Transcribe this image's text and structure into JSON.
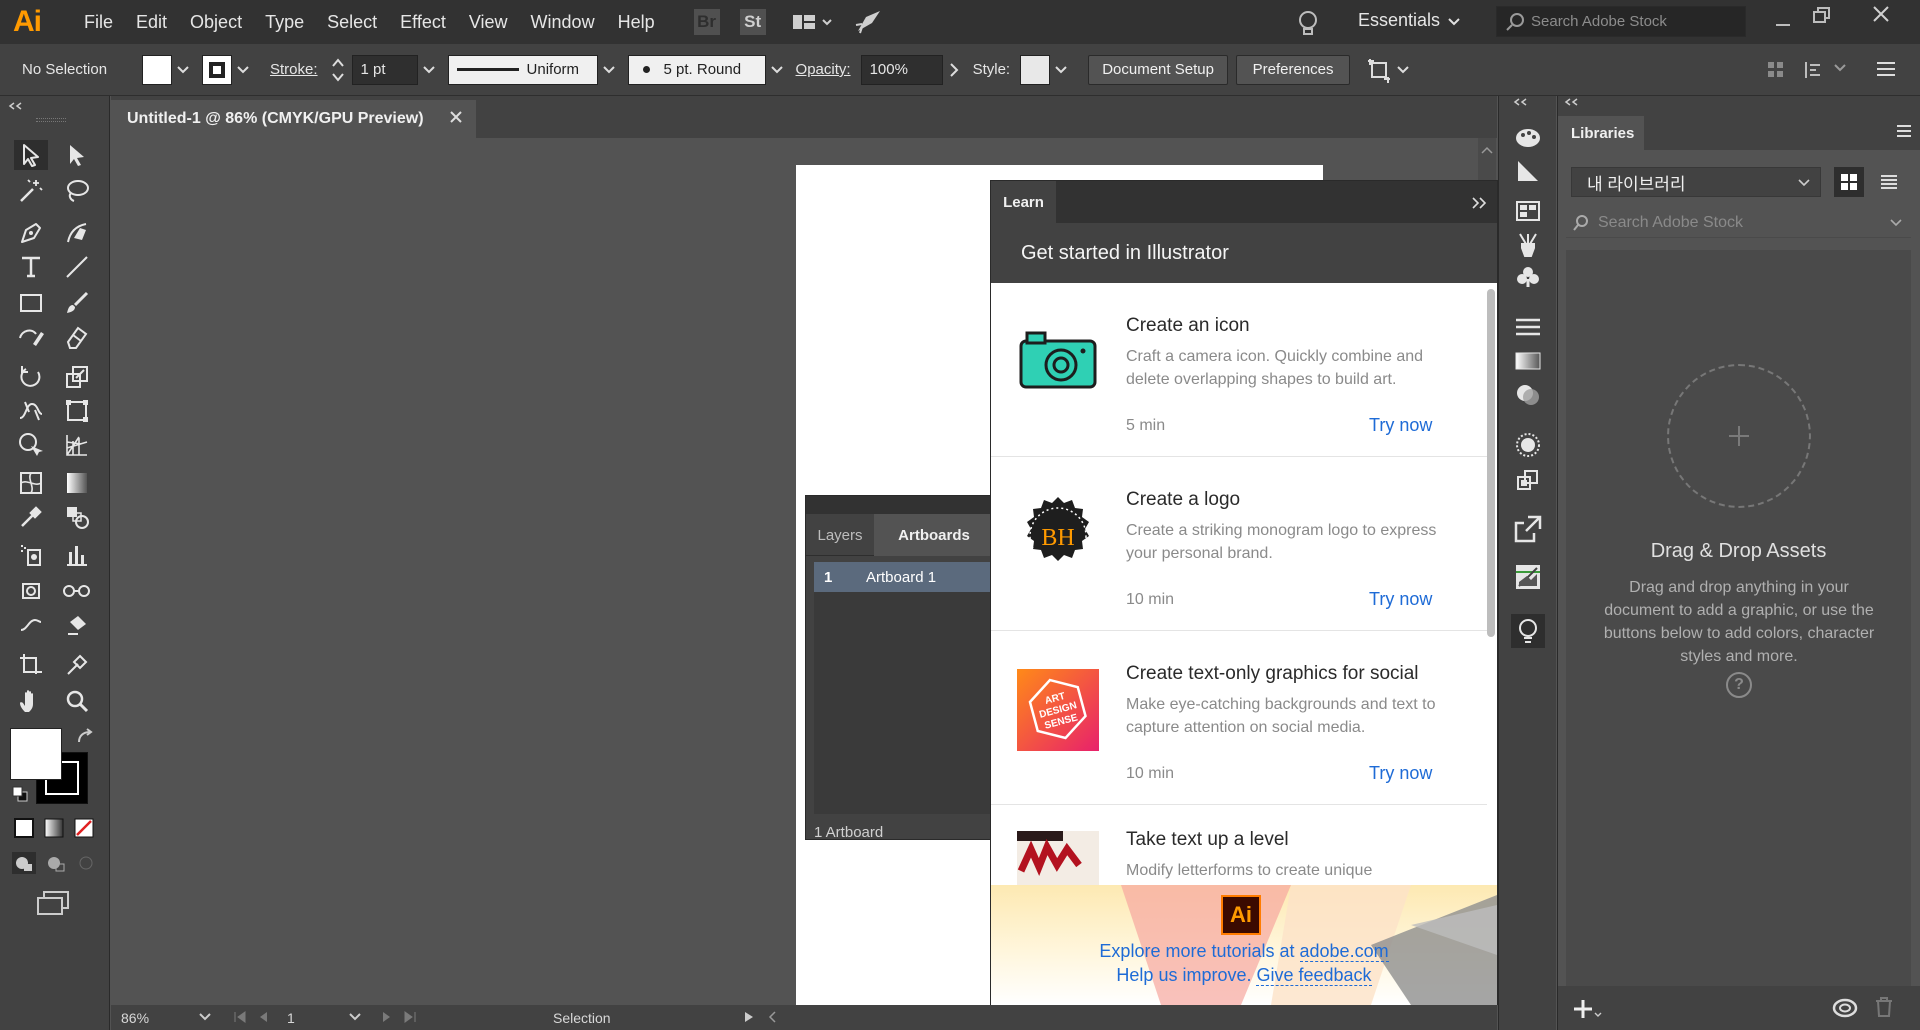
{
  "menubar": {
    "logo": "Ai",
    "items": [
      "File",
      "Edit",
      "Object",
      "Type",
      "Select",
      "Effect",
      "View",
      "Window",
      "Help"
    ],
    "bridge": "Br",
    "stock": "St",
    "workspace": "Essentials",
    "search_placeholder": "Search Adobe Stock"
  },
  "control": {
    "selection": "No Selection",
    "stroke_label": "Stroke:",
    "stroke_weight": "1 pt",
    "profile": "Uniform",
    "brush": "5 pt. Round",
    "opacity_label": "Opacity:",
    "opacity": "100%",
    "style_label": "Style:",
    "document_setup": "Document Setup",
    "preferences": "Preferences"
  },
  "document": {
    "tab_title": "Untitled-1 @ 86% (CMYK/GPU Preview)"
  },
  "status": {
    "zoom": "86%",
    "artboard_num": "1",
    "tool": "Selection"
  },
  "layers_panel": {
    "tabs": [
      "Layers",
      "Artboards"
    ],
    "row_index": "1",
    "row_name": "Artboard 1",
    "footer": "1 Artboard"
  },
  "learn": {
    "tab": "Learn",
    "title": "Get started in Illustrator",
    "cards": [
      {
        "title": "Create an icon",
        "desc": "Craft a camera icon. Quickly combine and delete overlapping shapes to build art.",
        "time": "5 min",
        "cta": "Try now",
        "icon": "camera-icon"
      },
      {
        "title": "Create a logo",
        "desc": "Create a striking monogram logo to express your personal brand.",
        "time": "10 min",
        "cta": "Try now",
        "icon": "monogram-logo",
        "badge": "BH"
      },
      {
        "title": "Create text-only graphics for social",
        "desc": "Make eye-catching backgrounds and text to capture attention on social media.",
        "time": "10 min",
        "cta": "Try now",
        "icon": "art-design-sense",
        "badge_lines": [
          "ART",
          "DESIGN",
          "SENSE"
        ]
      },
      {
        "title": "Take text up a level",
        "desc": "Modify letterforms to create unique",
        "icon": "letterforms-thumb"
      }
    ],
    "footer_logo": "Ai",
    "footer_text": "Explore more tutorials at ",
    "footer_link": "adobe.com",
    "footer_text2": "Help us improve. ",
    "footer_link2": "Give feedback"
  },
  "libraries": {
    "tab": "Libraries",
    "library": "내 라이브러리",
    "search_placeholder": "Search Adobe Stock",
    "empty_title": "Drag & Drop Assets",
    "empty_desc": "Drag and drop anything in your document to add a graphic, or use the buttons below to add colors, character styles and more."
  },
  "colors": {
    "accent_orange": "#ff9a00",
    "link_blue": "#1e6bd6",
    "teal": "#2fd0b4"
  }
}
